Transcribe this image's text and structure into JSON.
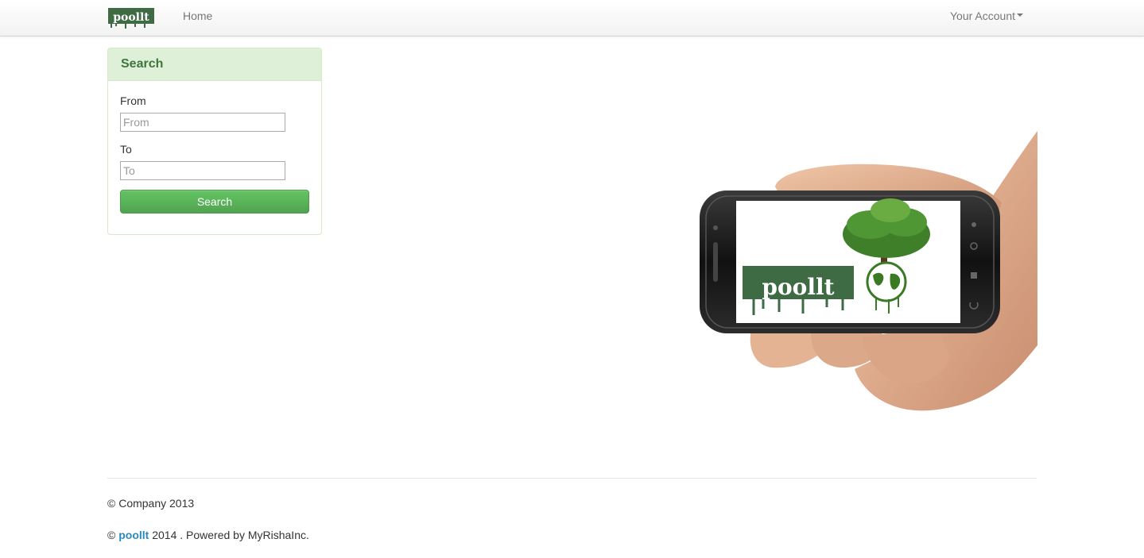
{
  "nav": {
    "brand": "poollt",
    "home": "Home",
    "account": "Your Account"
  },
  "search_panel": {
    "title": "Search",
    "from_label": "From",
    "from_placeholder": "From",
    "to_label": "To",
    "to_placeholder": "To",
    "button": "Search"
  },
  "hero": {
    "screen_logo": "poollt"
  },
  "footer": {
    "copyright": "© Company 2013",
    "powered_prefix": "© ",
    "powered_brand": "poollt",
    "powered_suffix": " 2014 . Powered by MyRishaInc."
  },
  "colors": {
    "brand_green": "#3e6b44",
    "panel_heading_bg": "#dff0d8",
    "panel_title": "#3c763d",
    "button_green": "#51a351",
    "link_blue": "#2a8ac0"
  },
  "icons": {
    "account_dropdown": "caret-down-icon"
  }
}
